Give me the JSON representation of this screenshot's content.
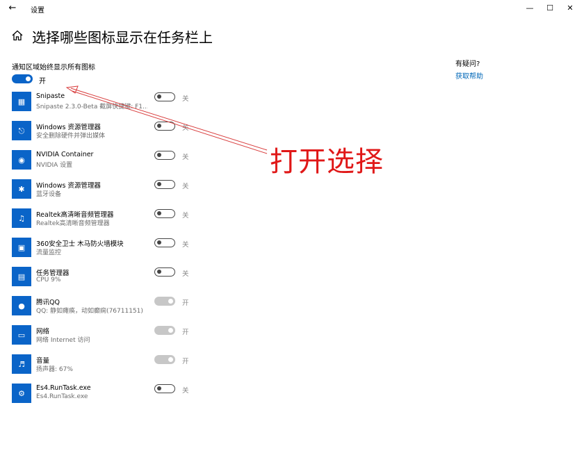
{
  "window": {
    "title": "设置",
    "back_icon": "back-arrow-icon",
    "controls": [
      "minimize-icon",
      "maximize-icon",
      "close-icon"
    ]
  },
  "page": {
    "title": "选择哪些图标显示在任务栏上",
    "home_icon": "home-icon"
  },
  "master": {
    "label": "通知区域始终显示所有图标",
    "state": "开"
  },
  "apps": [
    {
      "name": "Snipaste",
      "sub": "Snipaste 2.3.0-Beta 截屏快捷键: F1...",
      "state": "关",
      "toggle": "off",
      "icon": "snipaste-icon"
    },
    {
      "name": "Windows 资源管理器",
      "sub": "安全删除硬件并弹出媒体",
      "state": "关",
      "toggle": "off",
      "icon": "usb-eject-icon"
    },
    {
      "name": "NVIDIA Container",
      "sub": "NVIDIA 设置",
      "state": "关",
      "toggle": "off",
      "icon": "nvidia-icon"
    },
    {
      "name": "Windows 资源管理器",
      "sub": "蓝牙设备",
      "state": "关",
      "toggle": "off",
      "icon": "bluetooth-icon"
    },
    {
      "name": "Realtek高清晰音频管理器",
      "sub": "Realtek高清晰音频管理器",
      "state": "关",
      "toggle": "off",
      "icon": "realtek-audio-icon"
    },
    {
      "name": "360安全卫士 木马防火墙模块",
      "sub": "流量监控",
      "state": "关",
      "toggle": "off",
      "icon": "360-monitor-icon"
    },
    {
      "name": "任务管理器",
      "sub": "CPU 9%",
      "state": "关",
      "toggle": "off",
      "icon": "task-manager-icon"
    },
    {
      "name": "腾讯QQ",
      "sub": "QQ: 静如瘫痪，动如癫痫(76711151)",
      "state": "开",
      "toggle": "disabled",
      "icon": "qq-penguin-icon"
    },
    {
      "name": "网络",
      "sub": "网络 Internet 访问",
      "state": "开",
      "toggle": "disabled",
      "icon": "network-icon"
    },
    {
      "name": "音量",
      "sub": "扬声器: 67%",
      "state": "开",
      "toggle": "disabled",
      "icon": "speaker-icon"
    },
    {
      "name": "Es4.RunTask.exe",
      "sub": "Es4.RunTask.exe",
      "state": "关",
      "toggle": "off",
      "icon": "runtask-icon"
    }
  ],
  "help": {
    "title": "有疑问?",
    "link": "获取帮助"
  },
  "annotation": {
    "text": "打开选择",
    "color": "#e01818"
  },
  "colors": {
    "accent": "#0a64c8",
    "link": "#0067b8",
    "disabled_toggle": "#c7c7c7"
  }
}
